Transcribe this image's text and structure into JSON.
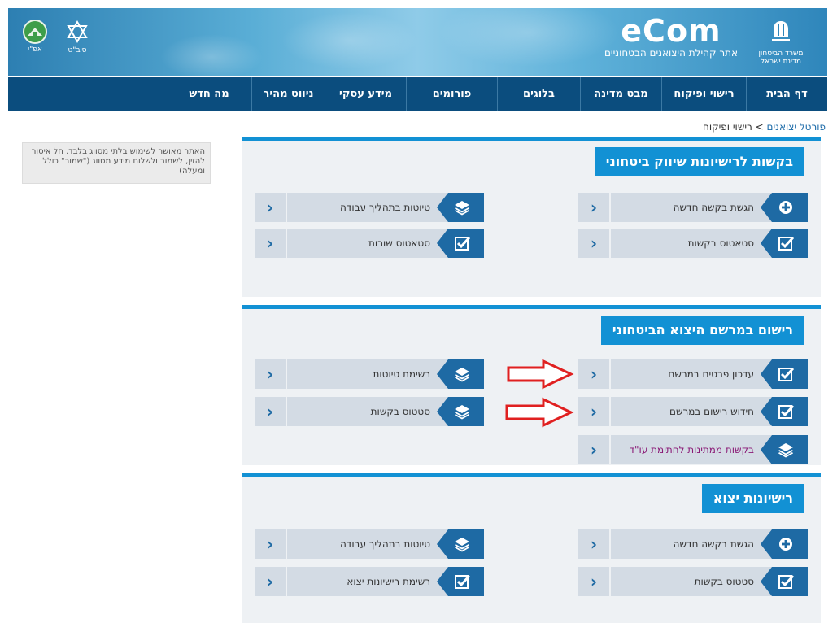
{
  "header": {
    "ministry_line1": "משרד הביטחון",
    "ministry_line2": "מדינת ישראל",
    "brand": "eCom",
    "brand_subtitle": "אתר קהילת היצואנים הבטחוניים",
    "sibat_label": "סיב\"ט",
    "apei_label": "אפ\"י"
  },
  "nav": {
    "items": [
      "דף הבית",
      "רישוי ופיקוח",
      "מבט מדינה",
      "בלוגים",
      "פורומים",
      "מידע עסקי",
      "ניווט מהיר",
      "מה חדש"
    ]
  },
  "breadcrumb": {
    "root": "פורטל יצואנים",
    "separator": ">",
    "current": "רישוי ופיקוח"
  },
  "notice": {
    "text": "האתר מאושר לשימוש בלתי מסווג בלבד. חל איסור להזין, לשמור ולשלוח מידע מסווג (\"שמור\" כולל ומעלה)"
  },
  "sections": [
    {
      "title": "בקשות לרישיונות שיווק ביטחוני",
      "buttons": [
        {
          "label": "הגשת בקשה חדשה",
          "icon": "plus-icon"
        },
        {
          "label": "טיוטות בתהליך עבודה",
          "icon": "layers-icon"
        },
        {
          "label": "סטאטוס בקשות",
          "icon": "checkbox-icon"
        },
        {
          "label": "סטאטוס שורות",
          "icon": "checkbox-icon"
        }
      ]
    },
    {
      "title": "רישום במרשם היצוא הביטחוני",
      "buttons": [
        {
          "label": "עדכון פרטים במרשם",
          "icon": "checkbox-icon"
        },
        {
          "label": "רשימת טיוטות",
          "icon": "layers-icon"
        },
        {
          "label": "חידוש רישום במרשם",
          "icon": "checkbox-icon"
        },
        {
          "label": "סטטוס בקשות",
          "icon": "layers-icon"
        },
        {
          "label": "בקשות ממתינות לחתימת עו\"ד",
          "icon": "layers-icon"
        }
      ]
    },
    {
      "title": "רישיונות יצוא",
      "buttons": [
        {
          "label": "הגשת בקשה חדשה",
          "icon": "plus-icon"
        },
        {
          "label": "טיוטות בתהליך עבודה",
          "icon": "layers-icon"
        },
        {
          "label": "סטטוס בקשות",
          "icon": "checkbox-icon"
        },
        {
          "label": "רשימת רישיונות יצוא",
          "icon": "checkbox-icon"
        }
      ]
    }
  ],
  "colors": {
    "nav_bg": "#0b4d7e",
    "section_accent": "#1291d4",
    "icon_bg": "#1e6aa4",
    "button_bg": "#d3dbe4",
    "annotation_arrow": "#e02020",
    "highlight_text": "#8a1a76"
  }
}
